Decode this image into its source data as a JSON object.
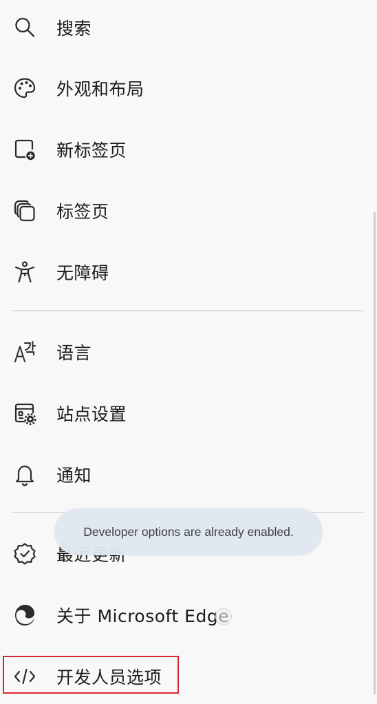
{
  "menu": {
    "items": [
      {
        "label": "搜索",
        "icon": "search-icon"
      },
      {
        "label": "外观和布局",
        "icon": "palette-icon"
      },
      {
        "label": "新标签页",
        "icon": "new-tab-icon"
      },
      {
        "label": "标签页",
        "icon": "tabs-icon"
      },
      {
        "label": "无障碍",
        "icon": "accessibility-icon"
      },
      {
        "label": "语言",
        "icon": "language-icon"
      },
      {
        "label": "站点设置",
        "icon": "site-settings-icon"
      },
      {
        "label": "通知",
        "icon": "bell-icon"
      },
      {
        "label": "最近更新",
        "icon": "verified-badge-icon"
      },
      {
        "label": "关于 Microsoft Edge",
        "icon": "edge-logo-icon"
      },
      {
        "label": "开发人员选项",
        "icon": "code-icon"
      }
    ]
  },
  "toast": {
    "message": "Developer options are already enabled."
  },
  "colors": {
    "background": "#f8f8f8",
    "text": "#1c1c1c",
    "divider": "#dcdcdc",
    "toast_background": "#e1e7ef",
    "highlight": "#d8262f"
  }
}
